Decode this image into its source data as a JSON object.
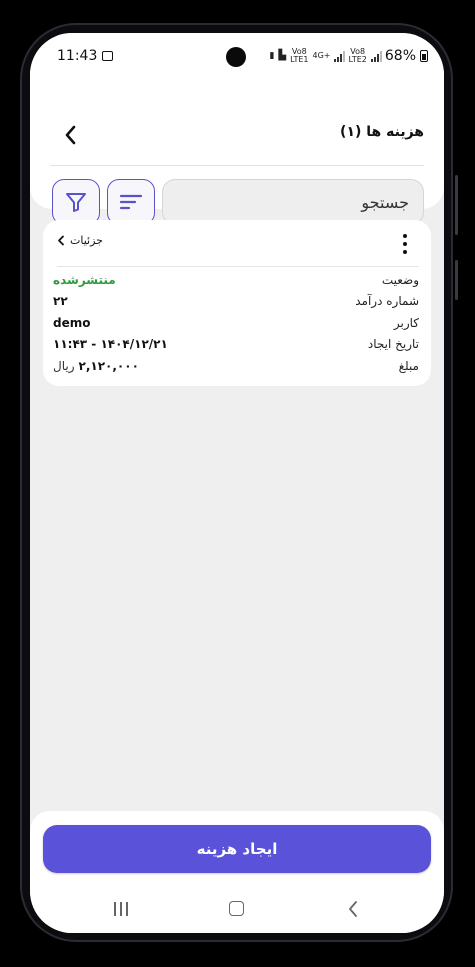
{
  "status_bar": {
    "time": "11:43",
    "battery": "68%",
    "sim1": "Vo8\nLTE1",
    "sim1_type": "4G+",
    "sim2": "Vo8\nLTE2"
  },
  "header": {
    "title": "هزینه ها (۱)",
    "search_placeholder": "جستجو"
  },
  "item": {
    "details_label": "جزئیات",
    "fields": [
      {
        "label": "وضعیت",
        "value": "منتشرشده",
        "status": "published"
      },
      {
        "label": "شماره درآمد",
        "value": "۲۲"
      },
      {
        "label": "کاربر",
        "value": "demo"
      },
      {
        "label": "تاریخ ایجاد",
        "value": "۱۴۰۴/۱۲/۲۱ - ۱۱:۴۳"
      },
      {
        "label": "مبلغ",
        "value": "۲,۱۲۰,۰۰۰",
        "unit": "ریال"
      }
    ]
  },
  "actions": {
    "create_label": "ایجاد هزینه"
  },
  "colors": {
    "accent": "#5a52d8",
    "status_green": "#2e9a3d"
  },
  "icons": [
    "back-chevron-icon",
    "filter-icon",
    "sort-icon",
    "more-vertical-icon",
    "chevron-left-icon"
  ]
}
